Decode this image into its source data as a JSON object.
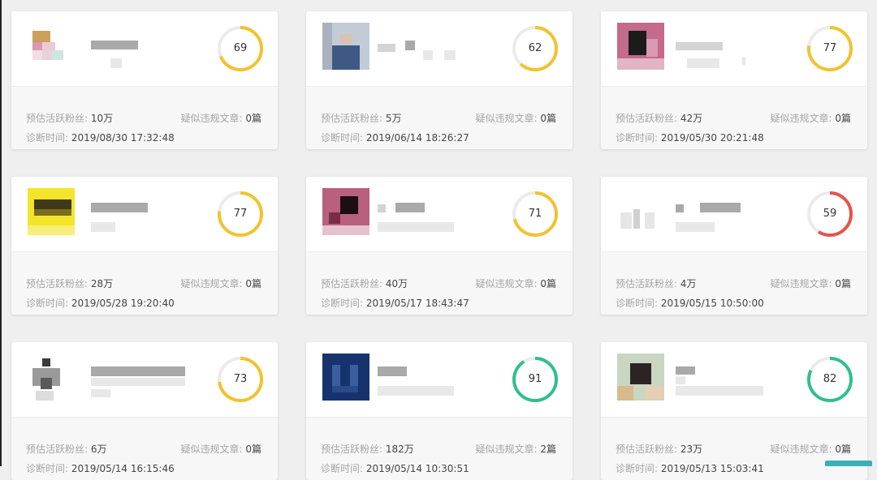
{
  "labels": {
    "fans": "预估活跃粉丝:",
    "suspicious": "疑似违规文章:",
    "time": "诊断时间:"
  },
  "colors": {
    "score_yellow": "#f2c230",
    "score_red": "#e5534b",
    "score_green": "#2fbf8f",
    "track": "#ebebeb"
  },
  "cards": [
    {
      "score": 69,
      "score_fraction": 0.69,
      "status_color": "#f2c230",
      "fans": "10万",
      "suspicious": "0篇",
      "time": "2019/08/30 17:32:48"
    },
    {
      "score": 62,
      "score_fraction": 0.62,
      "status_color": "#f2c230",
      "fans": "5万",
      "suspicious": "0篇",
      "time": "2019/06/14 18:26:27"
    },
    {
      "score": 77,
      "score_fraction": 0.77,
      "status_color": "#f2c230",
      "fans": "42万",
      "suspicious": "0篇",
      "time": "2019/05/30 20:21:48"
    },
    {
      "score": 77,
      "score_fraction": 0.77,
      "status_color": "#f2c230",
      "fans": "28万",
      "suspicious": "0篇",
      "time": "2019/05/28 19:20:40"
    },
    {
      "score": 71,
      "score_fraction": 0.71,
      "status_color": "#f2c230",
      "fans": "40万",
      "suspicious": "0篇",
      "time": "2019/05/17 18:43:47"
    },
    {
      "score": 59,
      "score_fraction": 0.59,
      "status_color": "#e5534b",
      "fans": "4万",
      "suspicious": "0篇",
      "time": "2019/05/15 10:50:00"
    },
    {
      "score": 73,
      "score_fraction": 0.73,
      "status_color": "#f2c230",
      "fans": "6万",
      "suspicious": "0篇",
      "time": "2019/05/14 16:15:46"
    },
    {
      "score": 91,
      "score_fraction": 0.91,
      "status_color": "#2fbf8f",
      "fans": "182万",
      "suspicious": "2篇",
      "time": "2019/05/14 10:30:51"
    },
    {
      "score": 82,
      "score_fraction": 0.82,
      "status_color": "#2fbf8f",
      "fans": "23万",
      "suspicious": "0篇",
      "time": "2019/05/13 15:03:41"
    }
  ]
}
